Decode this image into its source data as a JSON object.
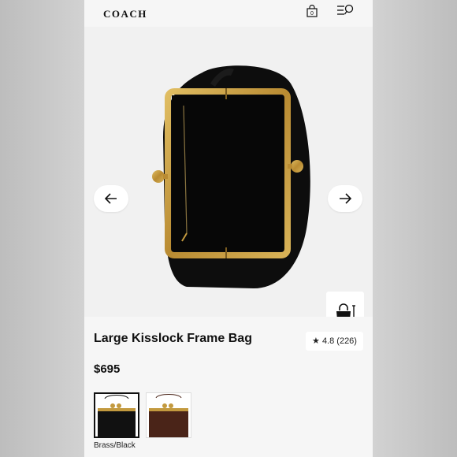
{
  "brand": {
    "logo_text": "COACH"
  },
  "header": {
    "bag_count": "0",
    "bag_icon": "shopping-bag-icon",
    "menu_icon": "menu-search-icon"
  },
  "gallery": {
    "prev_icon": "arrow-left-icon",
    "next_icon": "arrow-right-icon",
    "try_on_icon": "bag-size-icon"
  },
  "product": {
    "title": "Large Kisslock Frame Bag",
    "price": "$695",
    "rating_star": "★",
    "rating_text": "4.8 (226)"
  },
  "swatches": {
    "selected_label": "Brass/Black",
    "items": [
      {
        "color": "#111111",
        "selected": true
      },
      {
        "color": "#4a2418",
        "selected": false
      }
    ]
  },
  "colors": {
    "frame_gold": "#c39a3f",
    "bag_black": "#0d0d0d",
    "page_bg": "#f3f3f3"
  }
}
